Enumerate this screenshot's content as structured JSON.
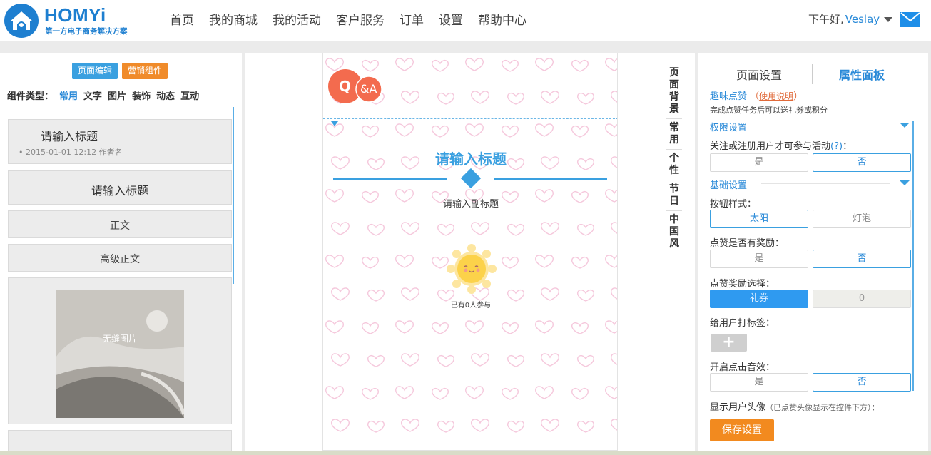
{
  "header": {
    "brand": "HOMYi",
    "brand_sub": "第一方电子商务解决方案",
    "nav": [
      "首页",
      "我的商城",
      "我的活动",
      "客户服务",
      "订单",
      "设置",
      "帮助中心"
    ],
    "greeting": "下午好,",
    "username": "Veslay"
  },
  "left": {
    "btn_edit": "页面编辑",
    "btn_marketing": "营销组件",
    "types_label": "组件类型：",
    "types": [
      "常用",
      "文字",
      "图片",
      "装饰",
      "动态",
      "互动"
    ],
    "tile_title1": "请输入标题",
    "tile_meta": "• 2015-01-01 12:12 作者名",
    "tile_title2": "请输入标题",
    "tile_body": "正文",
    "tile_adv": "高级正文",
    "tile_img": "--无缝图片--"
  },
  "center": {
    "qa_q": "Q",
    "qa_a": "&A",
    "title": "请输入标题",
    "subtitle": "请输入副标题",
    "joined": "已有0人参与",
    "vmenu": [
      "页面背景",
      "常用",
      "个性",
      "节日",
      "中国风"
    ]
  },
  "right": {
    "tab_page": "页面设置",
    "tab_props": "属性面板",
    "title": "趣味点赞",
    "paren_open": "（",
    "help": "使用说明",
    "paren_close": "）",
    "desc": "完成点赞任务后可以送礼券或积分",
    "sec_perm": "权限设置",
    "perm_label": "关注或注册用户才可参与活动",
    "perm_q": "(?)",
    "perm_colon": "：",
    "opt_yes": "是",
    "opt_no": "否",
    "sec_basic": "基础设置",
    "btn_style_label": "按钮样式：",
    "style_sun": "太阳",
    "style_bulb": "灯泡",
    "reward_label": "点赞是否有奖励：",
    "reward_choice_label": "点赞奖励选择：",
    "reward_coupon": "礼券",
    "reward_value": "0",
    "tag_label": "给用户打标签：",
    "plus": "+",
    "sound_label": "开启点击音效：",
    "avatar_label": "显示用户头像",
    "avatar_note": "（已点赞头像显示在控件下方）：",
    "save": "保存设置"
  },
  "colors": {
    "primary": "#2a8ad8",
    "orange": "#f28a1f",
    "heart": "#f5c8dc"
  }
}
